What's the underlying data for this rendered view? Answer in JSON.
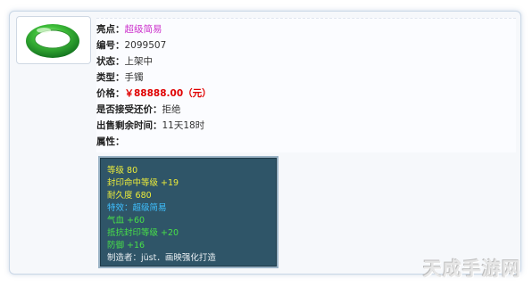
{
  "item": {
    "highlight_label": "亮点：",
    "highlight_value": "超级简易",
    "id_label": "编号：",
    "id_value": "2099507",
    "status_label": "状态：",
    "status_value": "上架中",
    "type_label": "类型：",
    "type_value": "手镯",
    "price_label": "价格：",
    "price_value": "￥88888.00（元）",
    "counter_label": "是否接受还价：",
    "counter_value": "拒绝",
    "time_label": "出售剩余时间：",
    "time_value": "11天18时",
    "attr_label": "属性："
  },
  "stats": [
    {
      "text": "等级 80",
      "color": "yellow"
    },
    {
      "text": "封印命中等级 +19",
      "color": "yellow"
    },
    {
      "text": "耐久度 680",
      "color": "yellow"
    },
    {
      "text": "特效：超级简易",
      "color": "blue"
    },
    {
      "text": "气血 +60",
      "color": "green"
    },
    {
      "text": "抵抗封印等级 +20",
      "color": "green"
    },
    {
      "text": "防御 +16",
      "color": "green"
    },
    {
      "text": "制造者：jüst．画映强化打造",
      "color": "white"
    }
  ],
  "watermark": "天成手游网"
}
